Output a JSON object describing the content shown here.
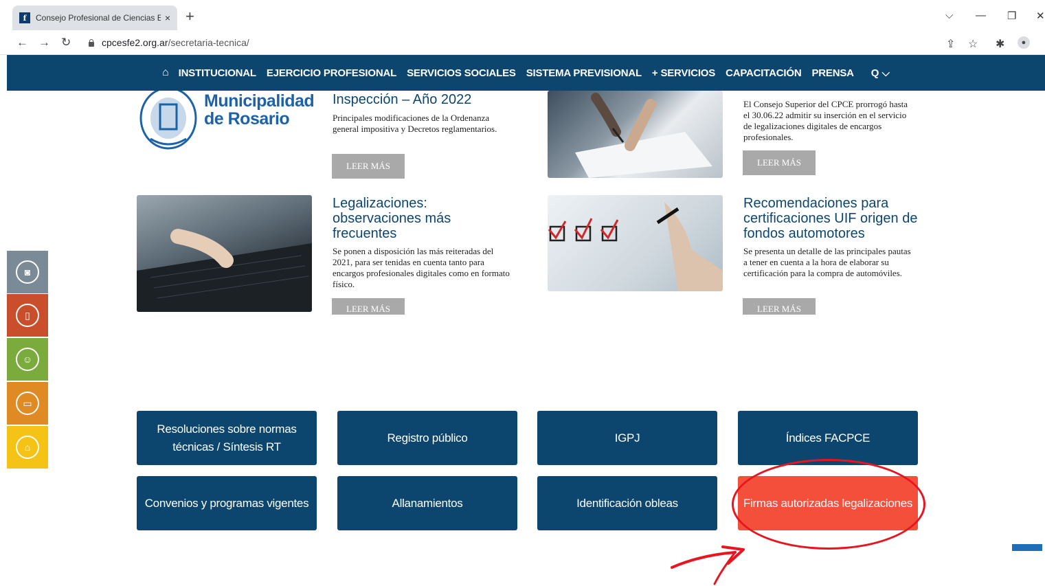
{
  "browser": {
    "tab_title": "Consejo Profesional de Ciencias E",
    "tab_close": "×",
    "new_tab": "+",
    "favicon_letter": "f",
    "url_host": "cpcesfe2.org.ar",
    "url_path": "/secretaria-tecnica/",
    "controls": {
      "list": "⌵",
      "minimize": "—",
      "maximize": "❐",
      "close": "✕"
    }
  },
  "nav": {
    "home_icon": "home-icon",
    "items": [
      "INSTITUCIONAL",
      "EJERCICIO PROFESIONAL",
      "SERVICIOS SOCIALES",
      "SISTEMA PREVISIONAL",
      "+ SERVICIOS",
      "CAPACITACIÓN",
      "PRENSA"
    ],
    "search_label": "Q ⌵"
  },
  "logo": {
    "line1": "Municipalidad",
    "line2": "de Rosario"
  },
  "news": [
    {
      "title": "Inspección – Año 2022",
      "text": "Principales modificaciones de la Ordenanza general impositiva y Decretos reglamentarios.",
      "button": "LEER MÁS"
    },
    {
      "title": "",
      "text": "El Consejo Superior del CPCE prorrogó hasta el 30.06.22 admitir su inserción en el servicio de legalizaciones digitales de encargos profesionales.",
      "button": "LEER MÁS"
    },
    {
      "title": "Legalizaciones: observaciones más frecuentes",
      "text": "Se ponen a disposición las más reiteradas del 2021, para ser tenidas en cuenta tanto para encargos profesionales digitales como en formato físico.",
      "button": "LEER MÁS"
    },
    {
      "title": "Recomendaciones para certificaciones UIF origen de fondos automotores",
      "text": "Se presenta un detalle de las principales pautas a tener en cuenta a la hora de elaborar su certificación para la compra de automóviles.",
      "button": "LEER MÁS"
    }
  ],
  "side_toolbar": [
    {
      "icon": "camera-icon",
      "color": "#7a8a96"
    },
    {
      "icon": "tablet-icon",
      "color": "#c94f2c"
    },
    {
      "icon": "group-icon",
      "color": "#7bab3c"
    },
    {
      "icon": "monitor-icon",
      "color": "#e08a24"
    },
    {
      "icon": "house-icon",
      "color": "#f5c316"
    }
  ],
  "quick_links": [
    "Resoluciones sobre normas técnicas / Síntesis RT",
    "Registro público",
    "IGPJ",
    "Índices FACPCE",
    "Convenios y programas vigentes",
    "Allanamientos",
    "Identificación obleas",
    "Firmas autorizadas legalizaciones"
  ],
  "colors": {
    "nav_bg": "#0c466f",
    "button_bg": "#0c466f",
    "highlight_button": "#f44f3b",
    "annotation_red": "#e8151f"
  }
}
